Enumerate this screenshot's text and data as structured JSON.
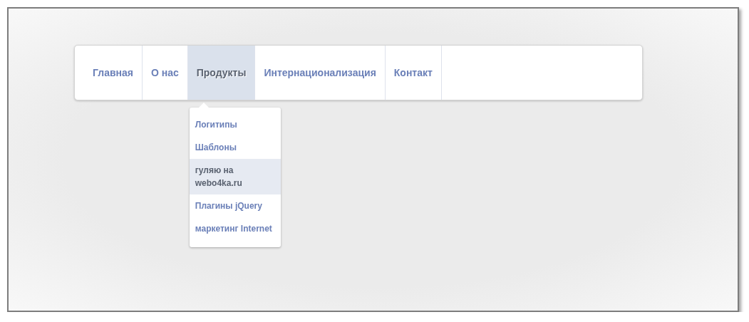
{
  "nav": {
    "items": [
      {
        "label": "Главная",
        "selected": false
      },
      {
        "label": "О нас",
        "selected": false
      },
      {
        "label": "Продукты",
        "selected": true,
        "submenu": [
          {
            "label": "Логитипы",
            "highlighted": false
          },
          {
            "label": "Шаблоны",
            "highlighted": false
          },
          {
            "label": "гуляю на webo4ka.ru",
            "highlighted": true
          },
          {
            "label": "Плагины jQuery",
            "highlighted": false
          },
          {
            "label": "маркетинг Internet",
            "highlighted": false
          }
        ]
      },
      {
        "label": "Интернационализация",
        "selected": false
      },
      {
        "label": "Контакт",
        "selected": false
      }
    ]
  }
}
